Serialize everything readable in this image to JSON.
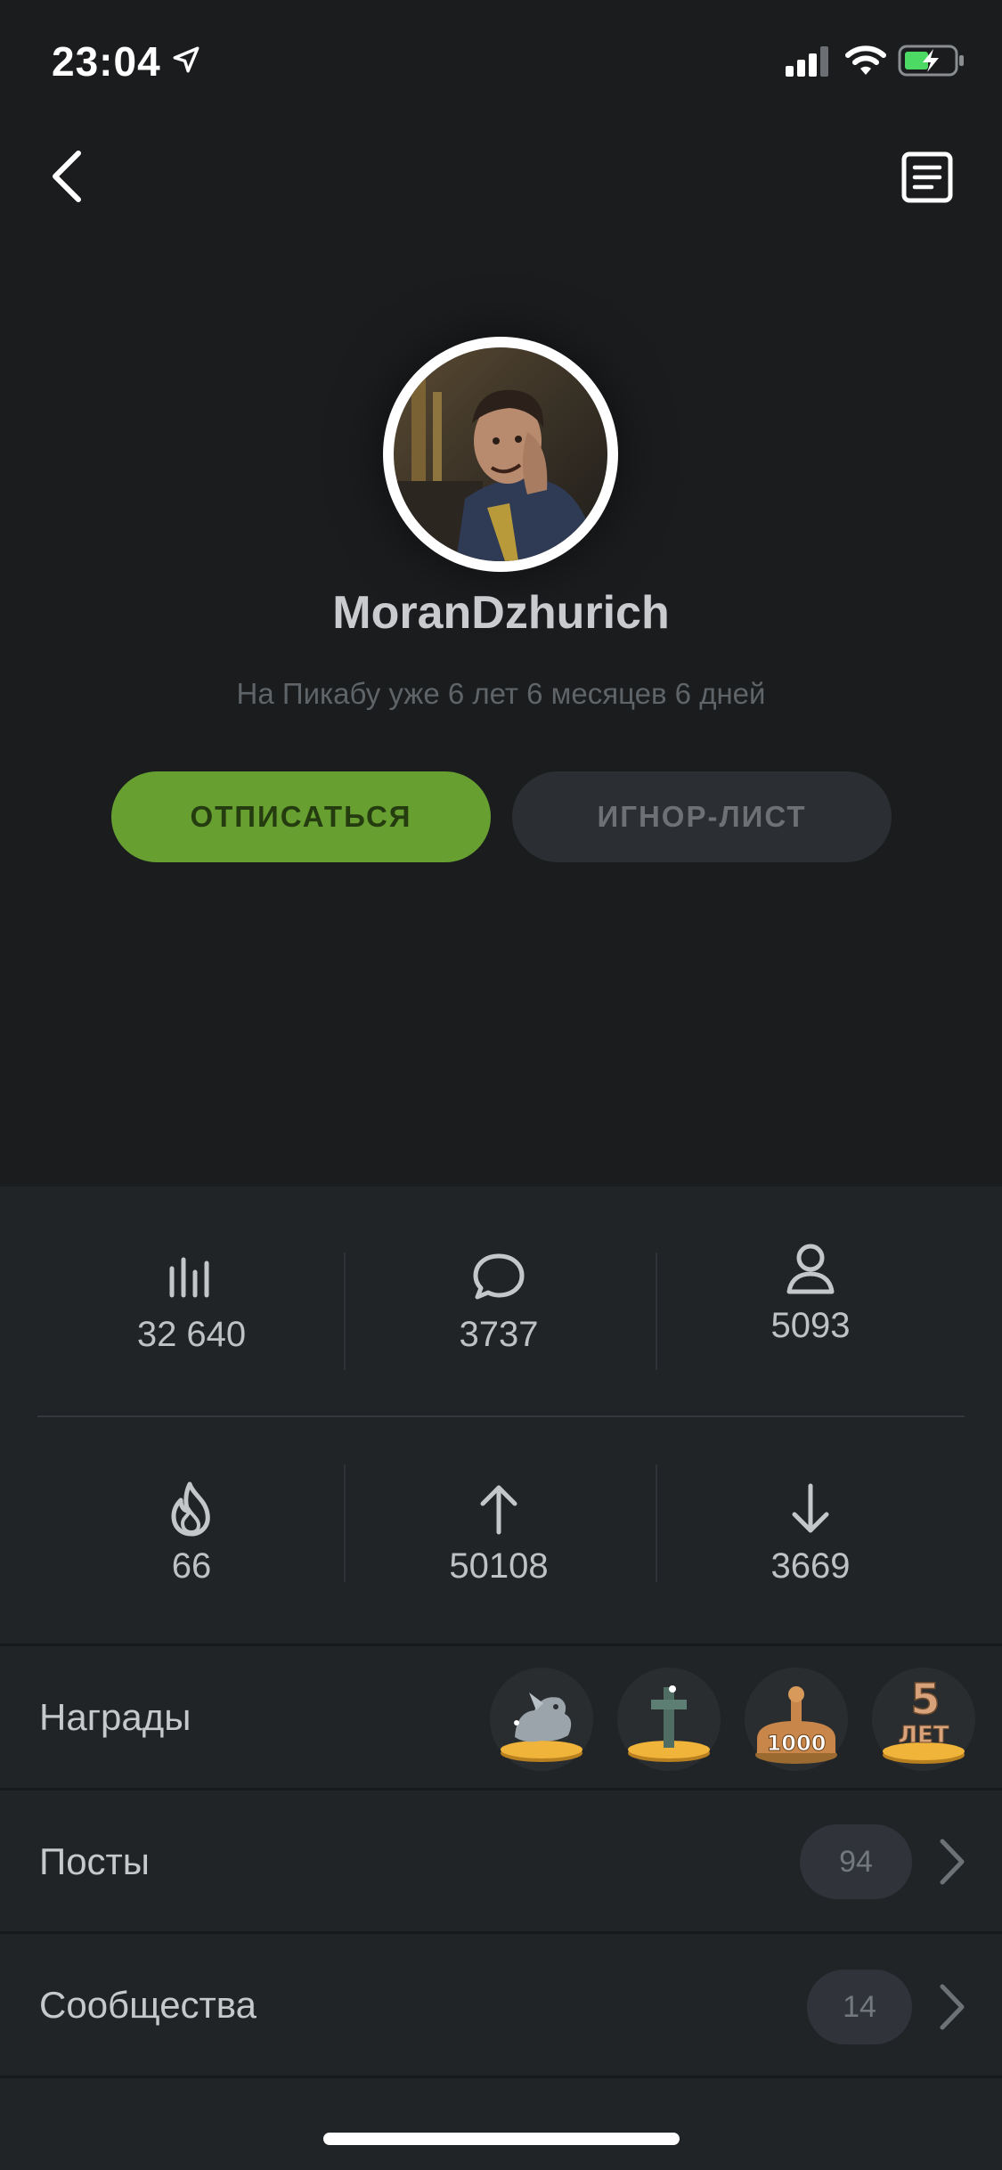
{
  "status_bar": {
    "time": "23:04"
  },
  "profile": {
    "username": "MoranDzhurich",
    "member_since": "На Пикабу уже 6 лет 6 месяцев 6 дней",
    "unsubscribe_label": "ОТПИСАТЬСЯ",
    "ignore_label": "ИГНОР-ЛИСТ"
  },
  "stats": [
    {
      "icon": "chart-bars-icon",
      "value": "32 640"
    },
    {
      "icon": "comment-icon",
      "value": "3737"
    },
    {
      "icon": "user-icon",
      "value": "5093"
    },
    {
      "icon": "fire-icon",
      "value": "66"
    },
    {
      "icon": "arrow-up-icon",
      "value": "50108"
    },
    {
      "icon": "arrow-down-icon",
      "value": "3669"
    }
  ],
  "awards": {
    "label": "Награды",
    "items": [
      {
        "icon": "dragon-award-icon"
      },
      {
        "icon": "cross-award-icon"
      },
      {
        "icon": "1000-award-icon",
        "text": "1000"
      },
      {
        "icon": "5-years-award-icon",
        "text": "5 ЛЕТ"
      }
    ]
  },
  "posts": {
    "label": "Посты",
    "count": "94"
  },
  "communities": {
    "label": "Сообщества",
    "count": "14"
  },
  "colors": {
    "accent_green": "#67a031",
    "background": "#1a1c1e",
    "panel": "#212427"
  }
}
